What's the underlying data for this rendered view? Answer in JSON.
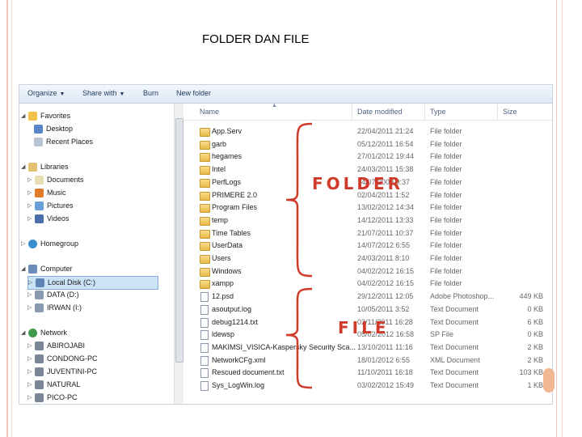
{
  "slide": {
    "title": "FOLDER DAN FILE"
  },
  "toolbar": {
    "organize": "Organize",
    "share_with": "Share with",
    "burn": "Burn",
    "new_folder": "New folder"
  },
  "nav": {
    "favorites": "Favorites",
    "desktop": "Desktop",
    "recent_places": "Recent Places",
    "libraries": "Libraries",
    "documents": "Documents",
    "music": "Music",
    "pictures": "Pictures",
    "videos": "Videos",
    "homegroup": "Homegroup",
    "computer": "Computer",
    "local_disk": "Local Disk (C:)",
    "data": "DATA (D:)",
    "irwan": "IRWAN (I:)",
    "network": "Network",
    "network_items": [
      "ABIROJABI",
      "CONDONG-PC",
      "JUVENTINI-PC",
      "NATURAL",
      "PICO-PC"
    ]
  },
  "columns": {
    "name": "Name",
    "date_modified": "Date modified",
    "type": "Type",
    "size": "Size"
  },
  "files": [
    {
      "name": "App.Serv",
      "date": "22/04/2011 21:24",
      "type": "File folder",
      "size": "",
      "kind": "folder"
    },
    {
      "name": "garb",
      "date": "05/12/2011 16:54",
      "type": "File folder",
      "size": "",
      "kind": "folder"
    },
    {
      "name": "hegames",
      "date": "27/01/2012 19:44",
      "type": "File folder",
      "size": "",
      "kind": "folder"
    },
    {
      "name": "Intel",
      "date": "24/03/2011 15:38",
      "type": "File folder",
      "size": "",
      "kind": "folder"
    },
    {
      "name": "PerfLogs",
      "date": "14/07/2009 9:37",
      "type": "File folder",
      "size": "",
      "kind": "folder"
    },
    {
      "name": "PRIMERE 2.0",
      "date": "02/04/2011 1:52",
      "type": "File folder",
      "size": "",
      "kind": "folder"
    },
    {
      "name": "Program Files",
      "date": "13/02/2012 14:34",
      "type": "File folder",
      "size": "",
      "kind": "folder"
    },
    {
      "name": "temp",
      "date": "14/12/2011 13:33",
      "type": "File folder",
      "size": "",
      "kind": "folder"
    },
    {
      "name": "Time Tables",
      "date": "21/07/2011 10:37",
      "type": "File folder",
      "size": "",
      "kind": "folder"
    },
    {
      "name": "UserData",
      "date": "14/07/2012 6:55",
      "type": "File folder",
      "size": "",
      "kind": "folder"
    },
    {
      "name": "Users",
      "date": "24/03/2011 8:10",
      "type": "File folder",
      "size": "",
      "kind": "folder"
    },
    {
      "name": "Windows",
      "date": "04/02/2012 16:15",
      "type": "File folder",
      "size": "",
      "kind": "folder"
    },
    {
      "name": "xampp",
      "date": "04/02/2012 16:15",
      "type": "File folder",
      "size": "",
      "kind": "folder"
    },
    {
      "name": "12.psd",
      "date": "29/12/2011 12:05",
      "type": "Adobe Photoshop...",
      "size": "449 KB",
      "kind": "file"
    },
    {
      "name": "asoutput.log",
      "date": "10/05/2011 3:52",
      "type": "Text Document",
      "size": "0 KB",
      "kind": "file"
    },
    {
      "name": "debug1214.txt",
      "date": "02/11/2011 16:28",
      "type": "Text Document",
      "size": "6 KB",
      "kind": "file"
    },
    {
      "name": "ldewsp",
      "date": "05/02/2012 16:58",
      "type": "SP File",
      "size": "0 KB",
      "kind": "file"
    },
    {
      "name": "MAKIMSI_VISICA-Kaspersky Security Sca...",
      "date": "13/10/2011 11:16",
      "type": "Text Document",
      "size": "2 KB",
      "kind": "file"
    },
    {
      "name": "NetworkCFg.xml",
      "date": "18/01/2012 6:55",
      "type": "XML Document",
      "size": "2 KB",
      "kind": "file"
    },
    {
      "name": "Rescued document.txt",
      "date": "11/10/2011 16:18",
      "type": "Text Document",
      "size": "103 KB",
      "kind": "file"
    },
    {
      "name": "Sys_LogWin.log",
      "date": "03/02/2012 15:49",
      "type": "Text Document",
      "size": "1 KB",
      "kind": "file"
    }
  ],
  "annotations": {
    "folder": "FOLDER",
    "file": "FILE"
  },
  "colors": {
    "annotation": "#d03a2a",
    "frame": "#f0c8b4",
    "selection": "#cce4f7"
  }
}
